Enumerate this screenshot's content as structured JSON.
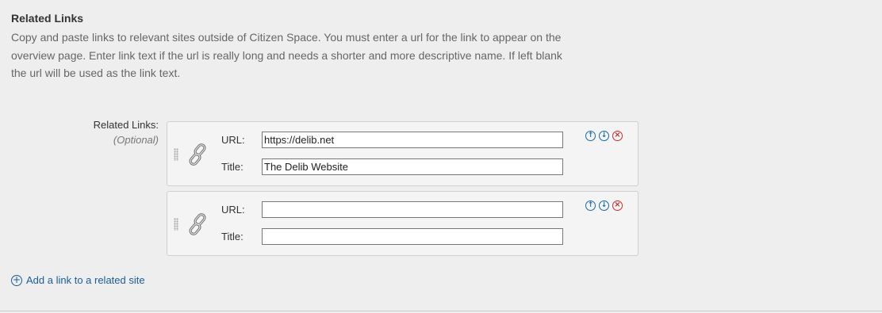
{
  "section": {
    "title": "Related Links",
    "help": "Copy and paste links to relevant sites outside of Citizen Space. You must enter a url for the link to appear on the overview page. Enter link text if the url is really long and needs a shorter and more descriptive name. If left blank the url will be used as the link text."
  },
  "field": {
    "label": "Related Links:",
    "optional": "(Optional)",
    "url_label": "URL:",
    "title_label": "Title:"
  },
  "links": [
    {
      "url": "https://delib.net",
      "title": "The Delib Website"
    },
    {
      "url": "",
      "title": ""
    }
  ],
  "controls": {
    "up_icon": "arrow-up-circle-icon",
    "down_icon": "arrow-down-circle-icon",
    "remove_icon": "close-circle-icon",
    "up_glyph": "↑",
    "down_glyph": "↓",
    "remove_glyph": "×"
  },
  "add_link": {
    "label": "Add a link to a related site",
    "icon": "plus-circle-icon",
    "glyph": "+"
  },
  "colors": {
    "background": "#eeeeee",
    "accent": "#1a6aa8",
    "danger": "#d12b2b"
  }
}
